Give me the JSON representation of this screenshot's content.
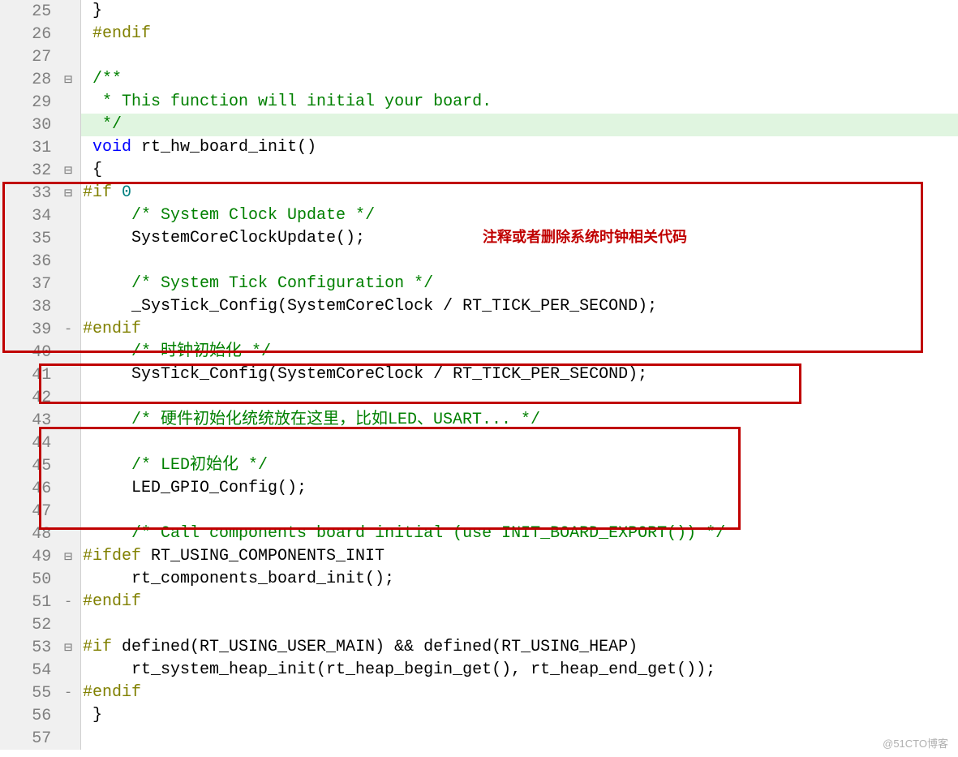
{
  "annotation_label": "注释或者删除系统时钟相关代码",
  "watermark": "@51CTO博客",
  "lines": [
    {
      "num": "25",
      "fold": "",
      "hl": false,
      "segs": [
        [
          "c-default",
          " "
        ],
        [
          "c-default",
          "}"
        ]
      ]
    },
    {
      "num": "26",
      "fold": "",
      "hl": false,
      "segs": [
        [
          "c-default",
          " "
        ],
        [
          "c-preproc",
          "#endif"
        ]
      ]
    },
    {
      "num": "27",
      "fold": "",
      "hl": false,
      "segs": [
        [
          "c-default",
          ""
        ]
      ]
    },
    {
      "num": "28",
      "fold": "⊟",
      "hl": false,
      "segs": [
        [
          "c-default",
          " "
        ],
        [
          "c-comment",
          "/**"
        ]
      ]
    },
    {
      "num": "29",
      "fold": "",
      "hl": false,
      "segs": [
        [
          "c-comment",
          "  * This function will initial your board."
        ]
      ]
    },
    {
      "num": "30",
      "fold": "",
      "hl": true,
      "segs": [
        [
          "c-comment",
          "  */"
        ]
      ]
    },
    {
      "num": "31",
      "fold": "",
      "hl": false,
      "segs": [
        [
          "c-default",
          " "
        ],
        [
          "c-keyword",
          "void"
        ],
        [
          "c-default",
          " rt_hw_board_init()"
        ]
      ]
    },
    {
      "num": "32",
      "fold": "⊟",
      "hl": false,
      "segs": [
        [
          "c-default",
          " "
        ],
        [
          "c-default",
          "{"
        ]
      ]
    },
    {
      "num": "33",
      "fold": "⊟",
      "hl": false,
      "segs": [
        [
          "c-preproc",
          "#if "
        ],
        [
          "c-number",
          "0"
        ]
      ]
    },
    {
      "num": "34",
      "fold": "",
      "hl": false,
      "segs": [
        [
          "c-default",
          "     "
        ],
        [
          "c-comment",
          "/* System Clock Update */"
        ]
      ]
    },
    {
      "num": "35",
      "fold": "",
      "hl": false,
      "segs": [
        [
          "c-default",
          "     SystemCoreClockUpdate();"
        ]
      ]
    },
    {
      "num": "36",
      "fold": "",
      "hl": false,
      "segs": [
        [
          "c-default",
          ""
        ]
      ]
    },
    {
      "num": "37",
      "fold": "",
      "hl": false,
      "segs": [
        [
          "c-default",
          "     "
        ],
        [
          "c-comment",
          "/* System Tick Configuration */"
        ]
      ]
    },
    {
      "num": "38",
      "fold": "",
      "hl": false,
      "segs": [
        [
          "c-default",
          "     _SysTick_Config(SystemCoreClock / RT_TICK_PER_SECOND);"
        ]
      ]
    },
    {
      "num": "39",
      "fold": "-",
      "hl": false,
      "segs": [
        [
          "c-preproc",
          "#endif"
        ]
      ]
    },
    {
      "num": "40",
      "fold": "",
      "hl": false,
      "segs": [
        [
          "c-default",
          "     "
        ],
        [
          "c-comment",
          "/* 时钟初始化 */"
        ]
      ]
    },
    {
      "num": "41",
      "fold": "",
      "hl": false,
      "segs": [
        [
          "c-default",
          "     SysTick_Config(SystemCoreClock / RT_TICK_PER_SECOND);"
        ]
      ]
    },
    {
      "num": "42",
      "fold": "",
      "hl": false,
      "segs": [
        [
          "c-default",
          ""
        ]
      ]
    },
    {
      "num": "43",
      "fold": "",
      "hl": false,
      "segs": [
        [
          "c-default",
          "     "
        ],
        [
          "c-comment",
          "/* 硬件初始化统统放在这里，比如LED、USART... */"
        ]
      ]
    },
    {
      "num": "44",
      "fold": "",
      "hl": false,
      "segs": [
        [
          "c-default",
          ""
        ]
      ]
    },
    {
      "num": "45",
      "fold": "",
      "hl": false,
      "segs": [
        [
          "c-default",
          "     "
        ],
        [
          "c-comment",
          "/* LED初始化 */"
        ]
      ]
    },
    {
      "num": "46",
      "fold": "",
      "hl": false,
      "segs": [
        [
          "c-default",
          "     LED_GPIO_Config();"
        ]
      ]
    },
    {
      "num": "47",
      "fold": "",
      "hl": false,
      "segs": [
        [
          "c-default",
          ""
        ]
      ]
    },
    {
      "num": "48",
      "fold": "",
      "hl": false,
      "segs": [
        [
          "c-default",
          "     "
        ],
        [
          "c-comment",
          "/* Call components board initial (use INIT_BOARD_EXPORT()) */"
        ]
      ]
    },
    {
      "num": "49",
      "fold": "⊟",
      "hl": false,
      "segs": [
        [
          "c-preproc",
          "#ifdef "
        ],
        [
          "c-default",
          "RT_USING_COMPONENTS_INIT"
        ]
      ]
    },
    {
      "num": "50",
      "fold": "",
      "hl": false,
      "segs": [
        [
          "c-default",
          "     rt_components_board_init();"
        ]
      ]
    },
    {
      "num": "51",
      "fold": "-",
      "hl": false,
      "segs": [
        [
          "c-preproc",
          "#endif"
        ]
      ]
    },
    {
      "num": "52",
      "fold": "",
      "hl": false,
      "segs": [
        [
          "c-default",
          ""
        ]
      ]
    },
    {
      "num": "53",
      "fold": "⊟",
      "hl": false,
      "segs": [
        [
          "c-preproc",
          "#if "
        ],
        [
          "c-default",
          "defined(RT_USING_USER_MAIN) && defined(RT_USING_HEAP)"
        ]
      ]
    },
    {
      "num": "54",
      "fold": "",
      "hl": false,
      "segs": [
        [
          "c-default",
          "     rt_system_heap_init(rt_heap_begin_get(), rt_heap_end_get());"
        ]
      ]
    },
    {
      "num": "55",
      "fold": "-",
      "hl": false,
      "segs": [
        [
          "c-preproc",
          "#endif"
        ]
      ]
    },
    {
      "num": "56",
      "fold": "",
      "hl": false,
      "segs": [
        [
          "c-default",
          " "
        ],
        [
          "c-default",
          "}"
        ]
      ]
    },
    {
      "num": "57",
      "fold": "",
      "hl": false,
      "segs": [
        [
          "c-default",
          ""
        ]
      ]
    }
  ]
}
